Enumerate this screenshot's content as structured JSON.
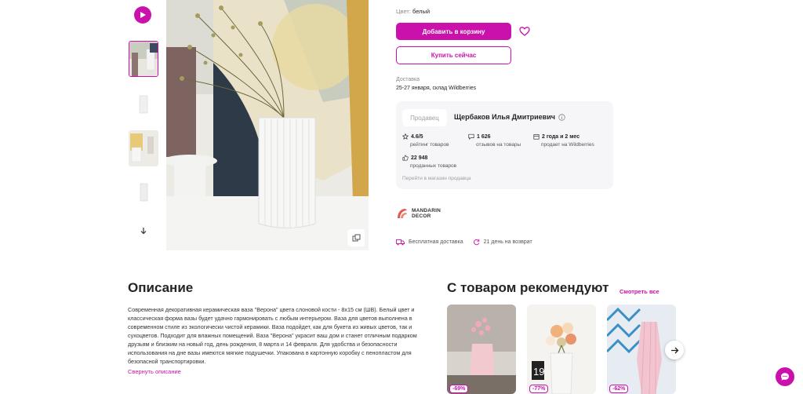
{
  "product": {
    "color_label": "Цвет:",
    "color_value": "белый",
    "add_to_cart": "Добавить в корзину",
    "buy_now": "Купить сейчас",
    "delivery_label": "Доставка",
    "delivery_value": "25-27 января, склад Wildberries"
  },
  "seller": {
    "tag": "Продавец",
    "name": "Щербаков Илья Дмитриевич",
    "stats": [
      {
        "value": "4.6/5",
        "label": "рейтинг товаров",
        "icon": "star-icon"
      },
      {
        "value": "1 626",
        "label": "отзывов на товары",
        "icon": "comment-icon"
      },
      {
        "value": "2 года и 2 мес",
        "label": "продает на Wildberries",
        "icon": "calendar-icon"
      },
      {
        "value": "22 948",
        "label": "проданных товаров",
        "icon": "thumb-up-icon"
      }
    ],
    "store_link": "Перейти в магазин продавца"
  },
  "brand": {
    "line1": "MANDARIN",
    "line2": "DECOR"
  },
  "perks": {
    "free_delivery": "Бесплатная доставка",
    "returns": "21 день на возврат"
  },
  "description": {
    "title": "Описание",
    "text": "Современная декоративная керамическая ваза \"Верона\" цвета слоновой кости - 8x15 см (ШВ). Белый цвет и классическая форма вазы будет удачно гармонировать с любым интерьером. Ваза для цветов выполнена в современном стиле из экологически чистой керамики. Ваза подойдет, как для букета из живых цветов, так и сухоцветов. Подходит для влажных помещений. Ваза \"Верона\" украсит ваш дом и станет отличным подарком друзьям и близким на новый год, день рождения, 8 марта и 14 февраля. Для удобства и безопасности использования на дне вазы имеются мягкие подушечки. Упакована в картонную коробку с пенопластом для безопасной транспортировки.",
    "toggle": "Свернуть описание"
  },
  "recommendations": {
    "title": "С товаром рекомендуют",
    "see_all": "Смотреть все",
    "items": [
      {
        "discount": "-69%"
      },
      {
        "discount": "-77%"
      },
      {
        "discount": "-62%"
      }
    ]
  },
  "colors": {
    "accent": "#cb11ab"
  }
}
